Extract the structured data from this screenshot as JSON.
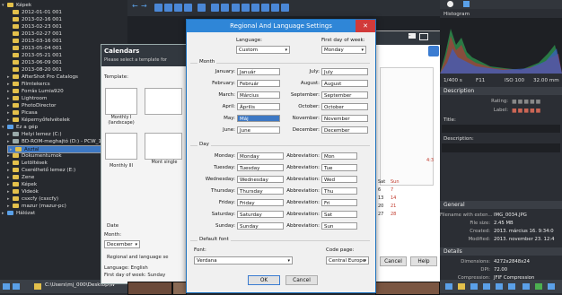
{
  "tree": {
    "root": "Képek",
    "items": [
      "2012-01-01 001",
      "2013-02-16 001",
      "2013-02-23 001",
      "2013-02-27 001",
      "2013-03-16 001",
      "2013-05-04 001",
      "2013-05-21 001",
      "2013-06-09 001",
      "2013-08-20 001",
      "AfterShot Pro Catalogs",
      "Filmtekercs",
      "Forrás Lumia920",
      "Lightroom",
      "PhotoDirector",
      "Picasa",
      "Képernyőfelvételek"
    ],
    "computer": "Ez a gép",
    "drives": [
      "Helyi lemez (C:)",
      "BD-ROM-meghajtó (D:) - PCW_1308_",
      "Asztal",
      "Dokumentumok",
      "Letöltések",
      "Cserélhető lemez (E:)",
      "Zene",
      "Képek",
      "Videók",
      "csxcfy (csxcfy)",
      "mazur (mazur-pc)"
    ],
    "network": "Hálózat",
    "path": "C:\\Users\\mj_000\\Desktop\\W"
  },
  "calendars": {
    "title": "Calendars",
    "subtitle": "Please select a template for",
    "template_label": "Template:",
    "tiles": [
      "Monthly I (landscape)",
      "Monthly III",
      "Mont single"
    ],
    "date_label": "Date",
    "month_label": "Month:",
    "month_value": "December",
    "regional_label": "Regional and language se",
    "lang_line": "Language: English",
    "fdow_line": "First day of week: Sunday"
  },
  "dialog": {
    "title": "Regional And Language Settings",
    "language_label": "Language:",
    "language_value": "Custom",
    "fdow_label": "First day of week:",
    "fdow_value": "Monday",
    "month_group": "Month",
    "months_left": [
      {
        "label": "January:",
        "value": "Január"
      },
      {
        "label": "February:",
        "value": "Február"
      },
      {
        "label": "March:",
        "value": "Március"
      },
      {
        "label": "April:",
        "value": "Április"
      },
      {
        "label": "May:",
        "value": "Máj"
      },
      {
        "label": "June:",
        "value": "June"
      }
    ],
    "months_right": [
      {
        "label": "July:",
        "value": "July"
      },
      {
        "label": "August:",
        "value": "August"
      },
      {
        "label": "September:",
        "value": "September"
      },
      {
        "label": "October:",
        "value": "October"
      },
      {
        "label": "November:",
        "value": "November"
      },
      {
        "label": "December:",
        "value": "December"
      }
    ],
    "day_group": "Day",
    "days": [
      {
        "label": "Monday:",
        "value": "Monday",
        "abbr": "Mon"
      },
      {
        "label": "Tuesday:",
        "value": "Tuesday",
        "abbr": "Tue"
      },
      {
        "label": "Wednesday:",
        "value": "Wednesday",
        "abbr": "Wed"
      },
      {
        "label": "Thursday:",
        "value": "Thursday",
        "abbr": "Thu"
      },
      {
        "label": "Friday:",
        "value": "Friday",
        "abbr": "Fri"
      },
      {
        "label": "Saturday:",
        "value": "Saturday",
        "abbr": "Sat"
      },
      {
        "label": "Sunday:",
        "value": "Sunday",
        "abbr": "Sun"
      }
    ],
    "abbr_label": "Abbreviation:",
    "font_group": "Default font",
    "font_label": "Font:",
    "font_value": "Verdana",
    "codepage_label": "Code page:",
    "codepage_value": "Central Europe",
    "ok": "OK",
    "cancel": "Cancel"
  },
  "behind": {
    "cancel": "Cancel",
    "help": "Help",
    "page_ratio": "4:3",
    "cal_head": [
      "Sat",
      "Sun"
    ],
    "cal_rows": [
      [
        "6",
        "7"
      ],
      [
        "13",
        "14"
      ],
      [
        "20",
        "21"
      ],
      [
        "27",
        "28"
      ]
    ],
    "cal_left": [
      "12",
      "19",
      "26"
    ]
  },
  "right": {
    "histogram": "Histogram",
    "exif": [
      "1/400 s",
      "F11",
      "ISO 100",
      "32.00 mm"
    ],
    "description": "Description",
    "rating_label": "Rating:",
    "label_label": "Label:",
    "title_label": "Title:",
    "desc_label": "Description:",
    "general": "General",
    "general_rows": [
      {
        "k": "Filename with exten...",
        "v": "IMG_0034.JPG"
      },
      {
        "k": "File size:",
        "v": "2.45 MB"
      },
      {
        "k": "Created:",
        "v": "2013. március 16. 9:34:0"
      },
      {
        "k": "Modified:",
        "v": "2013. november 23. 12:4"
      }
    ],
    "details": "Details",
    "details_rows": [
      {
        "k": "Dimensions:",
        "v": "4272x2848x24"
      },
      {
        "k": "DPI:",
        "v": "72.00"
      },
      {
        "k": "Compression:",
        "v": "JFIF Compression"
      }
    ]
  }
}
